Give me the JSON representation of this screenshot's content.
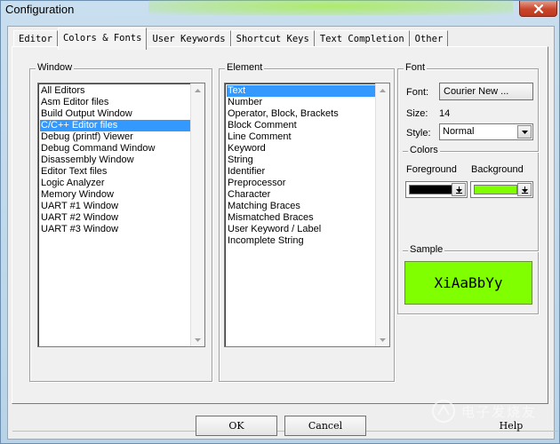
{
  "window": {
    "title": "Configuration"
  },
  "tabs": [
    {
      "label": "Editor"
    },
    {
      "label": "Colors & Fonts"
    },
    {
      "label": "User Keywords"
    },
    {
      "label": "Shortcut Keys"
    },
    {
      "label": "Text Completion"
    },
    {
      "label": "Other"
    }
  ],
  "active_tab": "Colors & Fonts",
  "window_group": {
    "label": "Window",
    "items": [
      "All Editors",
      "Asm Editor files",
      "Build Output Window",
      "C/C++ Editor files",
      "Debug (printf) Viewer",
      "Debug Command Window",
      "Disassembly Window",
      "Editor Text files",
      "Logic Analyzer",
      "Memory Window",
      "UART #1 Window",
      "UART #2 Window",
      "UART #3 Window"
    ],
    "selected": "C/C++ Editor files"
  },
  "element_group": {
    "label": "Element",
    "items": [
      "Text",
      "Number",
      "Operator, Block, Brackets",
      "Block Comment",
      "Line Comment",
      "Keyword",
      "String",
      "Identifier",
      "Preprocessor",
      "Character",
      "Matching Braces",
      "Mismatched Braces",
      "User Keyword / Label",
      "Incomplete String"
    ],
    "selected": "Text"
  },
  "font_group": {
    "label": "Font",
    "font_label": "Font:",
    "font_button": "Courier New ...",
    "size_label": "Size:",
    "size_value": "14",
    "style_label": "Style:",
    "style_value": "Normal"
  },
  "colors_group": {
    "label": "Colors",
    "foreground_label": "Foreground",
    "background_label": "Background",
    "foreground_color": "#000000",
    "background_color": "#80ff00"
  },
  "sample_group": {
    "label": "Sample",
    "text": "XiAaBbYy",
    "bg_color": "#80ff00"
  },
  "buttons": {
    "ok": "OK",
    "cancel": "Cancel",
    "help": "Help"
  },
  "watermark": {
    "text": "电子发烧友"
  }
}
